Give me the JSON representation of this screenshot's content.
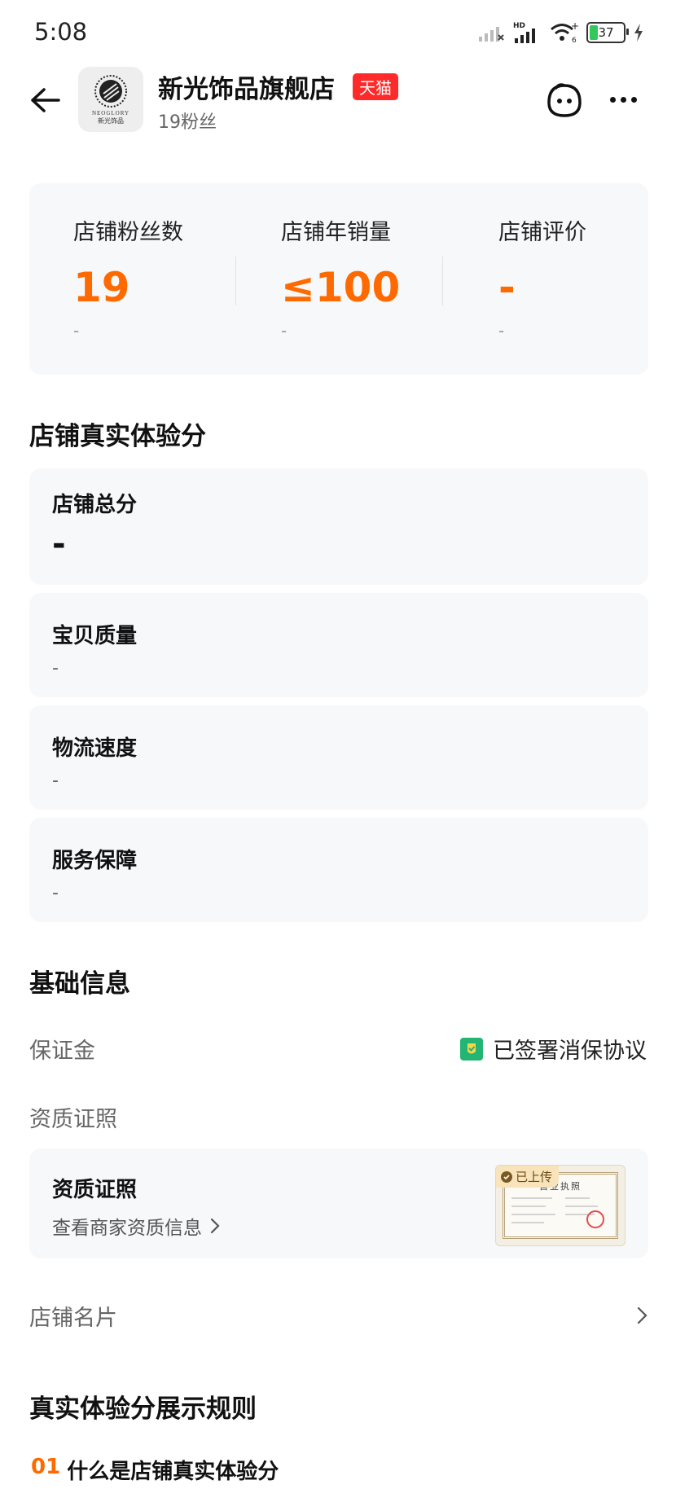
{
  "status_bar": {
    "time": "5:08",
    "battery": "37"
  },
  "header": {
    "shop_name": "新光饰品旗舰店",
    "badge": "天猫",
    "fans": "19粉丝",
    "logo": {
      "en": "NEOGLORY",
      "cn": "新光饰品"
    }
  },
  "stats": [
    {
      "label": "店铺粉丝数",
      "value": "19",
      "sub": "-"
    },
    {
      "label": "店铺年销量",
      "value": "≤100",
      "sub": "-"
    },
    {
      "label": "店铺评价",
      "value": "-",
      "sub": "-"
    }
  ],
  "experience": {
    "title": "店铺真实体验分",
    "total": {
      "label": "店铺总分",
      "value": "-"
    },
    "items": [
      {
        "label": "宝贝质量",
        "value": "-"
      },
      {
        "label": "物流速度",
        "value": "-"
      },
      {
        "label": "服务保障",
        "value": "-"
      }
    ]
  },
  "basic_info": {
    "title": "基础信息",
    "deposit_label": "保证金",
    "deposit_value": "已签署消保协议",
    "qualification_label": "资质证照",
    "license_card": {
      "title": "资质证照",
      "link": "查看商家资质信息",
      "upload_tag": "已上传",
      "thumb_title": "营业执照"
    },
    "business_card": "店铺名片"
  },
  "rules": {
    "title": "真实体验分展示规则",
    "item": {
      "num": "01",
      "text": "什么是店铺真实体验分"
    }
  },
  "colors": {
    "accent": "#ff6a00",
    "tmall": "#ff2a2a",
    "card_bg": "#f7f8fa",
    "shield": "#22b573"
  }
}
